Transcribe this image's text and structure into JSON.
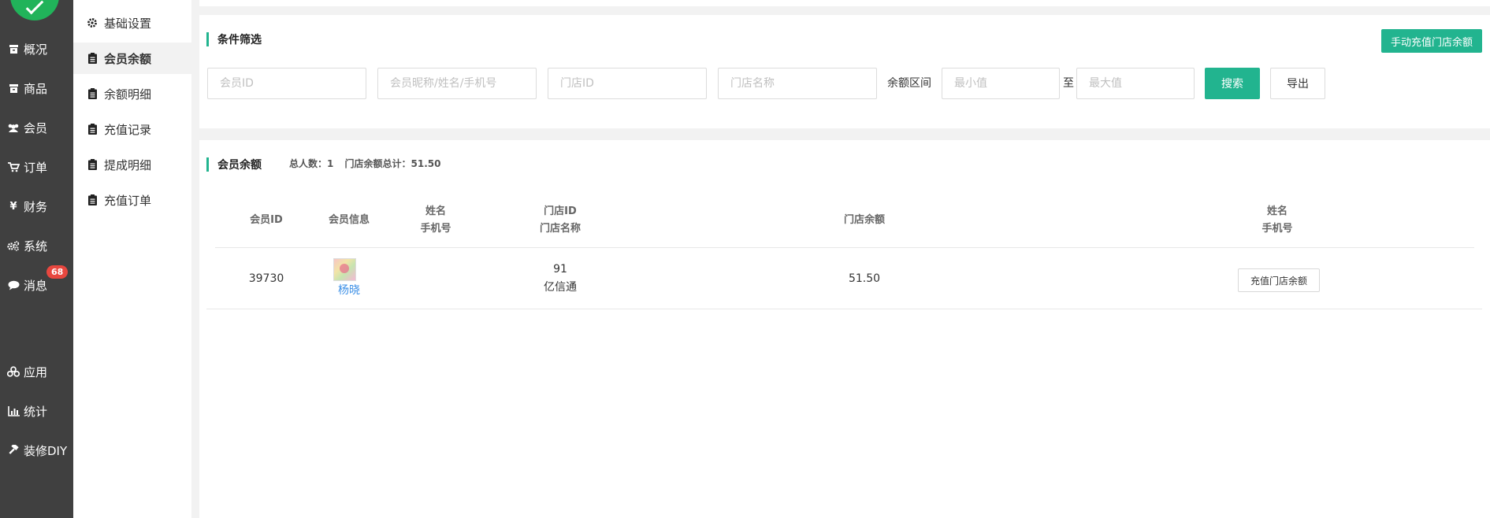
{
  "leftnav": {
    "items": [
      {
        "label": "概况",
        "icon": "archive-icon"
      },
      {
        "label": "商品",
        "icon": "archive-icon"
      },
      {
        "label": "会员",
        "icon": "users-icon"
      },
      {
        "label": "订单",
        "icon": "cart-icon"
      },
      {
        "label": "财务",
        "icon": "yen-icon"
      },
      {
        "label": "系统",
        "icon": "gears-icon"
      },
      {
        "label": "消息",
        "icon": "chat-icon"
      },
      {
        "label": "应用",
        "icon": "cubes-icon"
      },
      {
        "label": "统计",
        "icon": "bar-chart-icon"
      },
      {
        "label": "装修DIY",
        "icon": "gavel-icon"
      }
    ],
    "message_badge": "68"
  },
  "subnav": {
    "items": [
      {
        "label": "基础设置",
        "icon": "gear-icon"
      },
      {
        "label": "会员余额",
        "icon": "clipboard-icon"
      },
      {
        "label": "余额明细",
        "icon": "clipboard-icon"
      },
      {
        "label": "充值记录",
        "icon": "clipboard-icon"
      },
      {
        "label": "提成明细",
        "icon": "clipboard-icon"
      },
      {
        "label": "充值订单",
        "icon": "clipboard-icon"
      }
    ],
    "active_index": 1
  },
  "filter": {
    "title": "条件筛选",
    "manual_recharge_label": "手动充值门店余额",
    "member_id_placeholder": "会员ID",
    "member_name_placeholder": "会员昵称/姓名/手机号",
    "store_id_placeholder": "门店ID",
    "store_name_placeholder": "门店名称",
    "range_label": "余额区间",
    "min_placeholder": "最小值",
    "range_sep": "至",
    "max_placeholder": "最大值",
    "search_label": "搜索",
    "export_label": "导出"
  },
  "list": {
    "title": "会员余额",
    "total_people": "总人数：1",
    "store_balance_total": "门店余额总计：51.50",
    "headers": {
      "member_id": "会员ID",
      "member_info": "会员信息",
      "name_line1": "姓名",
      "name_line2": "手机号",
      "store_line1": "门店ID",
      "store_line2": "门店名称",
      "store_balance": "门店余额",
      "name2_line1": "姓名",
      "name2_line2": "手机号"
    },
    "rows": [
      {
        "member_id": "39730",
        "member_name": "杨晓",
        "store_id": "91",
        "store_name": "亿信通",
        "store_balance": "51.50",
        "action_label": "充值门店余额"
      }
    ]
  },
  "colors": {
    "accent": "#22b48f",
    "nav_bg": "#404040",
    "badge": "#e8473f",
    "logo": "#21b35a",
    "link": "#3a8ee6"
  }
}
